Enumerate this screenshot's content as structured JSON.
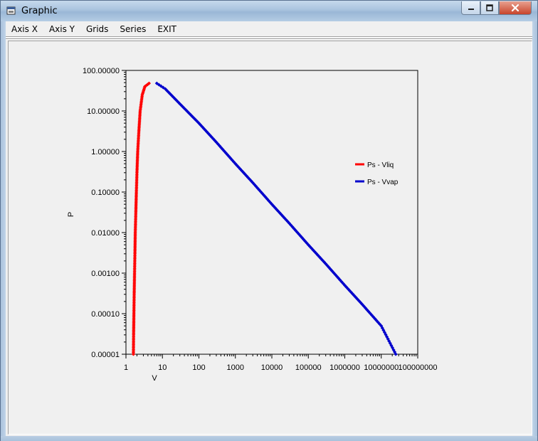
{
  "window": {
    "title": "Graphic",
    "icon": "window-app-icon",
    "controls": [
      "minimize-icon",
      "maximize-icon",
      "close-icon"
    ]
  },
  "menu": {
    "items": [
      {
        "label": "Axis X"
      },
      {
        "label": "Axis Y"
      },
      {
        "label": "Grids"
      },
      {
        "label": "Series"
      },
      {
        "label": "EXIT"
      }
    ]
  },
  "chart_data": {
    "type": "scatter",
    "title": "",
    "xlabel": "V",
    "ylabel": "P",
    "xscale": "log",
    "yscale": "log",
    "xlim": [
      1,
      100000000
    ],
    "ylim": [
      1e-05,
      100
    ],
    "grid": false,
    "legend_position": "right",
    "x_tick_labels": [
      "1",
      "10",
      "100",
      "1000",
      "10000",
      "100000",
      "1000000",
      "10000000",
      "100000000"
    ],
    "y_tick_labels": [
      "100.00000",
      "10.00000",
      "1.00000",
      "0.10000",
      "0.01000",
      "0.00100",
      "0.00010",
      "0.00001"
    ],
    "series": [
      {
        "name": "Ps - Vliq",
        "color": "#ff0000",
        "points": [
          [
            1.6,
            1e-05
          ],
          [
            1.62,
            3e-05
          ],
          [
            1.65,
            0.0001
          ],
          [
            1.68,
            0.0003
          ],
          [
            1.72,
            0.001
          ],
          [
            1.76,
            0.003
          ],
          [
            1.8,
            0.01
          ],
          [
            1.86,
            0.03
          ],
          [
            1.93,
            0.1
          ],
          [
            2.0,
            0.3
          ],
          [
            2.1,
            1
          ],
          [
            2.25,
            3
          ],
          [
            2.45,
            10
          ],
          [
            2.8,
            25
          ],
          [
            3.3,
            40
          ],
          [
            4.3,
            48
          ]
        ]
      },
      {
        "name": "Ps - Vvap",
        "color": "#0000cc",
        "points": [
          [
            7.0,
            48
          ],
          [
            12,
            35
          ],
          [
            30,
            15
          ],
          [
            100,
            5
          ],
          [
            300,
            1.7
          ],
          [
            1000,
            0.5
          ],
          [
            3000,
            0.17
          ],
          [
            10000,
            0.05
          ],
          [
            30000,
            0.017
          ],
          [
            100000,
            0.005
          ],
          [
            300000,
            0.0017
          ],
          [
            1000000,
            0.0005
          ],
          [
            3000000,
            0.00017
          ],
          [
            10000000,
            5e-05
          ],
          [
            25000000,
            1e-05
          ]
        ]
      }
    ]
  }
}
